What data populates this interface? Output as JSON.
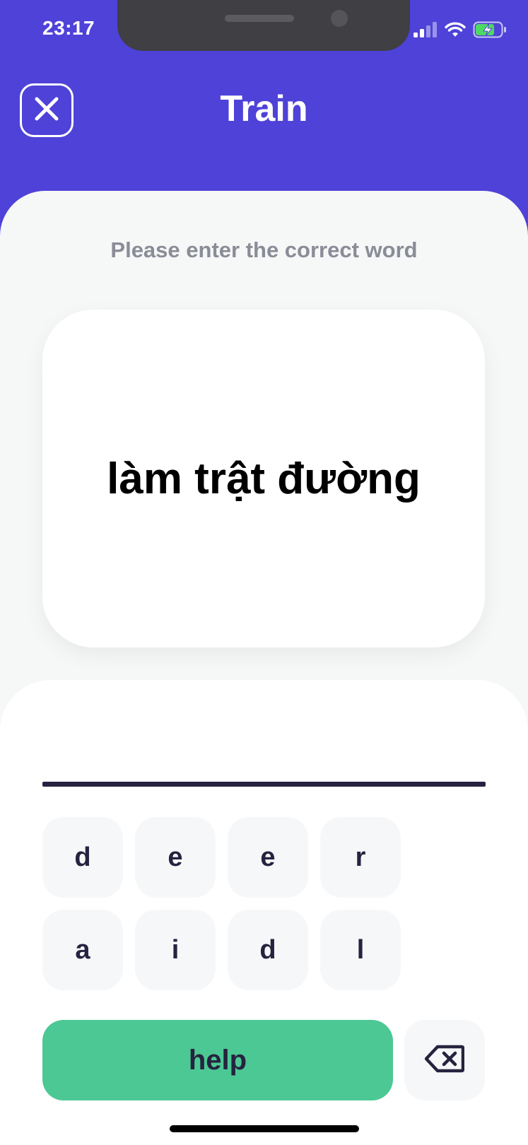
{
  "status_bar": {
    "time": "23:17",
    "icons": [
      "cellular-signal-icon",
      "wifi-icon",
      "battery-charging-icon"
    ]
  },
  "header": {
    "title": "Train",
    "close_icon": "close-icon"
  },
  "prompt": {
    "instruction": "Please enter the correct word",
    "word": "làm trật đường"
  },
  "answer": {
    "value": ""
  },
  "keyboard": {
    "row1": [
      "d",
      "e",
      "e",
      "r"
    ],
    "row2": [
      "a",
      "i",
      "d",
      "l"
    ],
    "help_label": "help",
    "backspace_icon": "backspace-icon"
  },
  "colors": {
    "brand": "#4E42D8",
    "help_button": "#4CC894",
    "text_dark": "#25233F"
  }
}
